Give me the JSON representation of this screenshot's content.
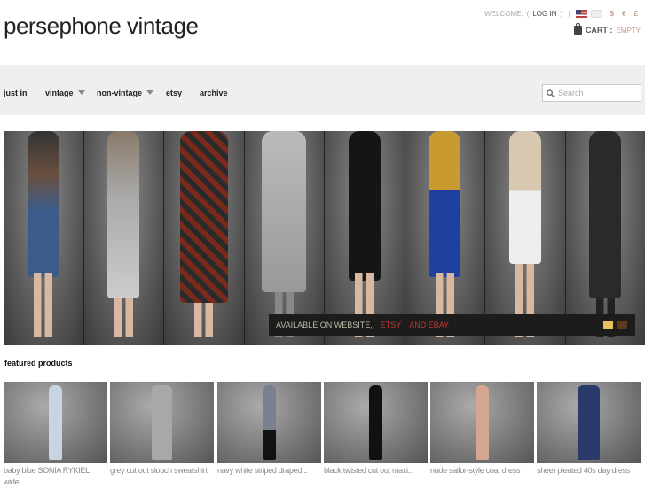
{
  "header": {
    "logo": "persephone vintage",
    "welcome": "WELCOME.",
    "login": "LOG IN",
    "currencies": [
      "$",
      "€",
      "£"
    ],
    "cart_label": "CART :",
    "cart_status": "EMPTY"
  },
  "nav": {
    "items": [
      {
        "label": "just in"
      },
      {
        "label": "vintage"
      },
      {
        "label": "non-vintage"
      },
      {
        "label": "etsy"
      },
      {
        "label": "archive"
      }
    ],
    "search_placeholder": "Search"
  },
  "banner": {
    "caption": "AVAILABLE ON WEBSITE,",
    "link1": "ETSY",
    "link2": "AND EBAY",
    "dot_colors": [
      "#e8c060",
      "#5a3a1a"
    ]
  },
  "featured": {
    "title": "featured products",
    "products": [
      {
        "title": "baby blue SONIA RYKIEL wide...",
        "color": "#c8d4e0"
      },
      {
        "title": "grey cut out slouch sweatshirt",
        "color": "#a8a8a8"
      },
      {
        "title": "navy white striped draped...",
        "color": "#7a8090"
      },
      {
        "title": "black twisted cut out maxi...",
        "color": "#111111"
      },
      {
        "title": "nude sailor-style coat dress",
        "color": "#d4a890"
      },
      {
        "title": "sheer pleated 40s day dress",
        "color": "#2a3a6a"
      }
    ]
  }
}
